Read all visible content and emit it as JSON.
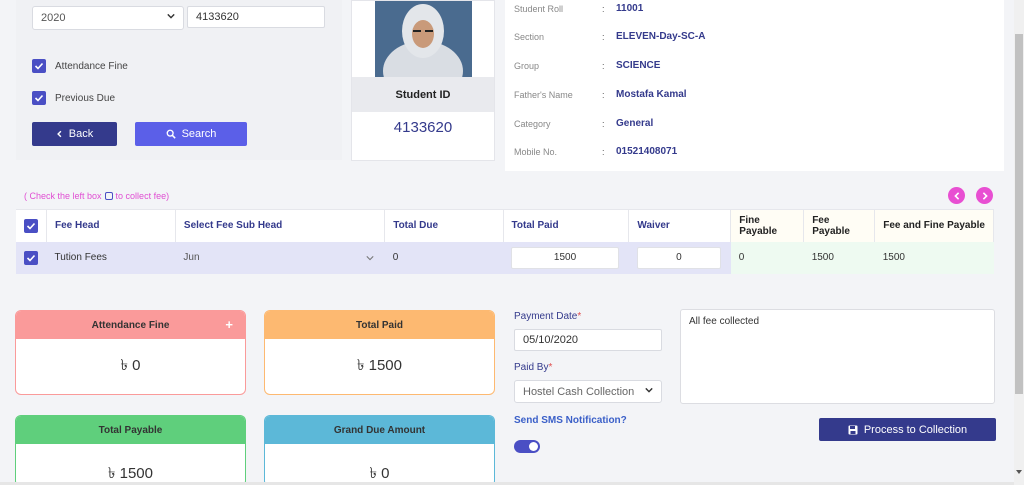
{
  "filter": {
    "year_value": "2020",
    "student_id_value": "4133620",
    "attendance_fine_label": "Attendance Fine",
    "previous_due_label": "Previous Due",
    "back_label": "Back",
    "search_label": "Search"
  },
  "student_card": {
    "id_label": "Student ID",
    "id_value": "4133620"
  },
  "student_info": [
    {
      "label": "Student Roll",
      "value": "11001"
    },
    {
      "label": "Section",
      "value": "ELEVEN-Day-SC-A"
    },
    {
      "label": "Group",
      "value": "SCIENCE"
    },
    {
      "label": "Father's Name",
      "value": "Mostafa Kamal"
    },
    {
      "label": "Category",
      "value": "General"
    },
    {
      "label": "Mobile No.",
      "value": "01521408071"
    }
  ],
  "info_colon": ":",
  "hint": {
    "before": "( Check the left box",
    "after": "to collect fee)"
  },
  "fee_table": {
    "headers": [
      "Fee Head",
      "Select Fee Sub Head",
      "Total Due",
      "Total Paid",
      "Waiver",
      "Fine Payable",
      "Fee Payable",
      "Fee and Fine Payable"
    ],
    "rows": [
      {
        "fee_head": "Tution Fees",
        "sub_head": "Jun",
        "total_due": "0",
        "total_paid": "1500",
        "waiver": "0",
        "fine_payable": "0",
        "fee_payable": "1500",
        "fee_and_fine": "1500"
      }
    ]
  },
  "summary": {
    "attendance_fine": {
      "label": "Attendance Fine",
      "value": "৳ 0",
      "plus": "+"
    },
    "total_paid": {
      "label": "Total Paid",
      "value": "৳ 1500"
    },
    "total_payable": {
      "label": "Total Payable",
      "value": "৳ 1500"
    },
    "grand_due": {
      "label": "Grand Due Amount",
      "value": "৳ 0"
    }
  },
  "payment": {
    "date_label": "Payment Date",
    "date_value": "05/10/2020",
    "paid_by_label": "Paid By",
    "paid_by_value": "Hostel Cash Collection",
    "required_mark": "*",
    "note_value": "All fee collected",
    "sms_label": "Send SMS Notification?",
    "process_label": "Process to Collection"
  },
  "colors": {
    "primary": "#343a8c",
    "accent": "#5b5fe8",
    "attendance_head": "#fa9a9a",
    "paid_head": "#fdb971",
    "payable_head": "#5fcf7c",
    "grand_head": "#5cb8d8",
    "pink": "#e84fd2"
  }
}
